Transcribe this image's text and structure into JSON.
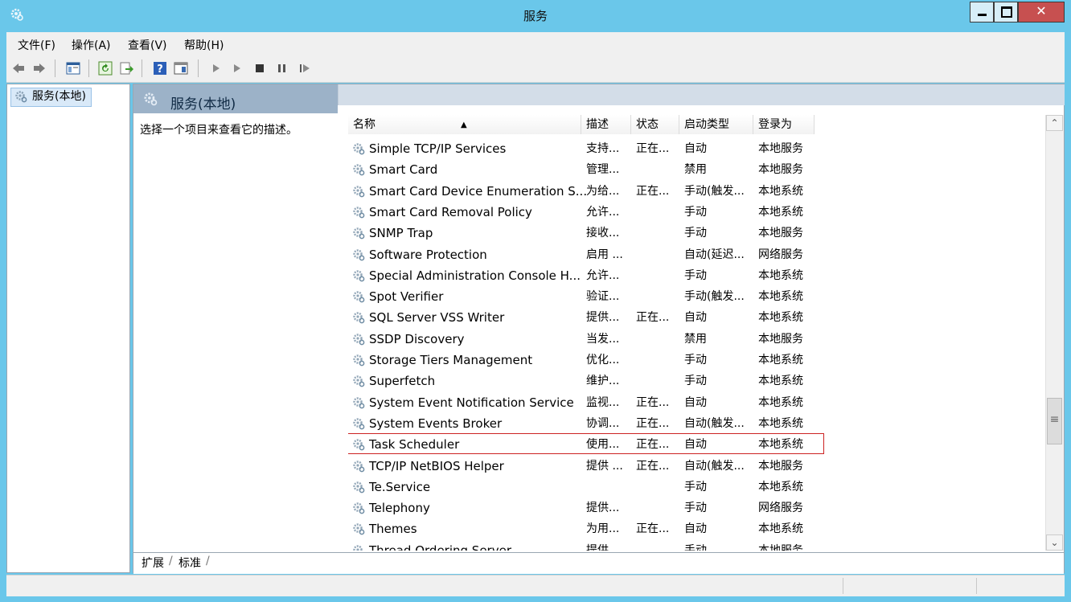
{
  "window": {
    "title": "服务"
  },
  "menu": [
    "文件(F)",
    "操作(A)",
    "查看(V)",
    "帮助(H)"
  ],
  "toolbar": {
    "buttons": [
      "back-icon",
      "forward-icon",
      "show-hide-console-tree-icon",
      "refresh-icon",
      "export-list-icon",
      "help-icon",
      "properties-icon",
      "start-service-icon",
      "start-service-alt-icon",
      "stop-service-icon",
      "pause-service-icon",
      "restart-service-icon"
    ]
  },
  "tree": {
    "root": "服务(本地)"
  },
  "main": {
    "header": "服务(本地)",
    "description_prompt": "选择一个项目来查看它的描述。",
    "columns": [
      "名称",
      "描述",
      "状态",
      "启动类型",
      "登录为"
    ],
    "rows": [
      {
        "name": "Simple TCP/IP Services",
        "desc": "支持...",
        "status": "正在...",
        "startup": "自动",
        "logon": "本地服务"
      },
      {
        "name": "Smart Card",
        "desc": "管理...",
        "status": "",
        "startup": "禁用",
        "logon": "本地服务"
      },
      {
        "name": "Smart Card Device Enumeration S...",
        "desc": "为给...",
        "status": "正在...",
        "startup": "手动(触发...",
        "logon": "本地系统"
      },
      {
        "name": "Smart Card Removal Policy",
        "desc": "允许...",
        "status": "",
        "startup": "手动",
        "logon": "本地系统"
      },
      {
        "name": "SNMP Trap",
        "desc": "接收...",
        "status": "",
        "startup": "手动",
        "logon": "本地服务"
      },
      {
        "name": "Software Protection",
        "desc": "启用 ...",
        "status": "",
        "startup": "自动(延迟...",
        "logon": "网络服务"
      },
      {
        "name": "Special Administration Console H...",
        "desc": "允许...",
        "status": "",
        "startup": "手动",
        "logon": "本地系统"
      },
      {
        "name": "Spot Verifier",
        "desc": "验证...",
        "status": "",
        "startup": "手动(触发...",
        "logon": "本地系统"
      },
      {
        "name": "SQL Server VSS Writer",
        "desc": "提供...",
        "status": "正在...",
        "startup": "自动",
        "logon": "本地系统"
      },
      {
        "name": "SSDP Discovery",
        "desc": "当发...",
        "status": "",
        "startup": "禁用",
        "logon": "本地服务"
      },
      {
        "name": "Storage Tiers Management",
        "desc": "优化...",
        "status": "",
        "startup": "手动",
        "logon": "本地系统"
      },
      {
        "name": "Superfetch",
        "desc": "维护...",
        "status": "",
        "startup": "手动",
        "logon": "本地系统"
      },
      {
        "name": "System Event Notification Service",
        "desc": "监视...",
        "status": "正在...",
        "startup": "自动",
        "logon": "本地系统"
      },
      {
        "name": "System Events Broker",
        "desc": "协调...",
        "status": "正在...",
        "startup": "自动(触发...",
        "logon": "本地系统"
      },
      {
        "name": "Task Scheduler",
        "desc": "使用...",
        "status": "正在...",
        "startup": "自动",
        "logon": "本地系统",
        "highlighted": true
      },
      {
        "name": "TCP/IP NetBIOS Helper",
        "desc": "提供 ...",
        "status": "正在...",
        "startup": "自动(触发...",
        "logon": "本地服务"
      },
      {
        "name": "Te.Service",
        "desc": "",
        "status": "",
        "startup": "手动",
        "logon": "本地系统"
      },
      {
        "name": "Telephony",
        "desc": "提供...",
        "status": "",
        "startup": "手动",
        "logon": "网络服务"
      },
      {
        "name": "Themes",
        "desc": "为用...",
        "status": "正在...",
        "startup": "自动",
        "logon": "本地系统"
      },
      {
        "name": "Thread Ordering Server",
        "desc": "提供...",
        "status": "",
        "startup": "手动",
        "logon": "本地服务"
      }
    ],
    "tabs": [
      "扩展",
      "标准"
    ]
  },
  "colors": {
    "titlebar": "#6ac7ea",
    "header": "#9cb2c8",
    "highlight_border": "#cc2222",
    "close": "#c75050"
  }
}
